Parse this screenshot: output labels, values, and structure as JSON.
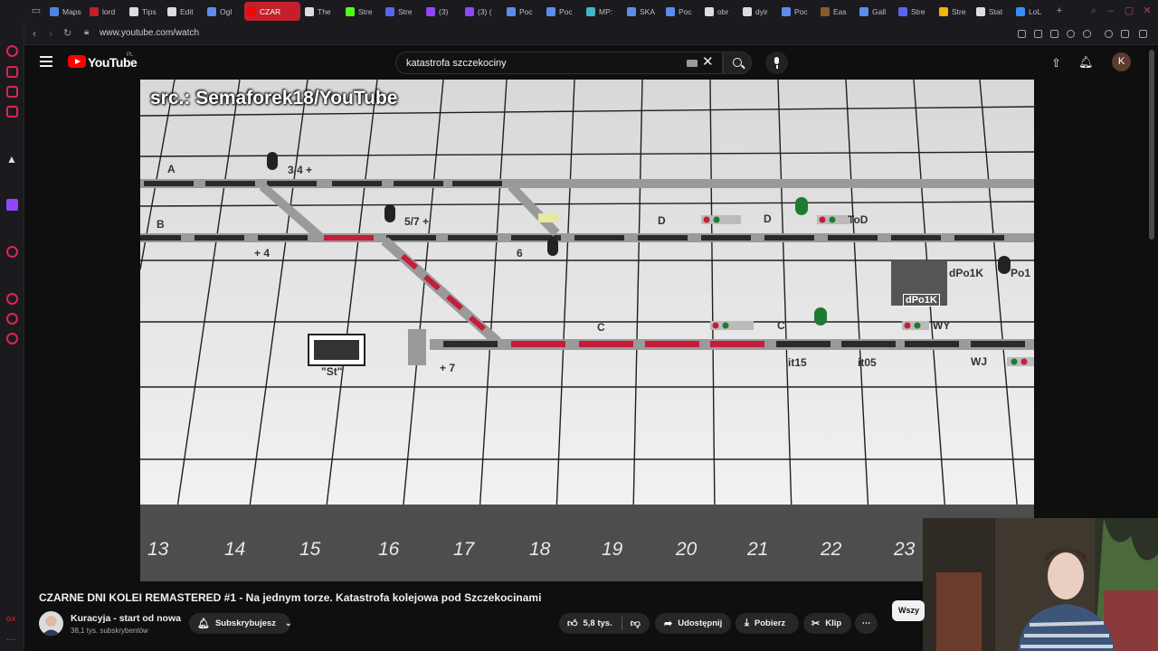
{
  "browser": {
    "tabs": [
      {
        "title": "Maps",
        "color": "#4a86e8"
      },
      {
        "title": "lord",
        "color": "#c0202c"
      },
      {
        "title": "Tips",
        "color": "#dddddd"
      },
      {
        "title": "Edit",
        "color": "#dddddd"
      },
      {
        "title": "Ogl",
        "color": "#5b8def"
      },
      {
        "title": "CZAR",
        "color": "#ff0000"
      },
      {
        "title": "The",
        "color": "#dddddd"
      },
      {
        "title": "Stre",
        "color": "#53fc18"
      },
      {
        "title": "Stre",
        "color": "#5865f2"
      },
      {
        "title": "(3)",
        "color": "#9146ff"
      },
      {
        "title": "(3) (",
        "color": "#9146ff"
      },
      {
        "title": "Poc",
        "color": "#5b8def"
      },
      {
        "title": "Poc",
        "color": "#5b8def"
      },
      {
        "title": "MP:",
        "color": "#3fb6c9"
      },
      {
        "title": "SKA",
        "color": "#5b8def"
      },
      {
        "title": "Poc",
        "color": "#5b8def"
      },
      {
        "title": "obr",
        "color": "#dddddd"
      },
      {
        "title": "dyir",
        "color": "#dddddd"
      },
      {
        "title": "Poc",
        "color": "#5b8def"
      },
      {
        "title": "Eas",
        "color": "#8b5a2b"
      },
      {
        "title": "Gall",
        "color": "#5b8def"
      },
      {
        "title": "Stre",
        "color": "#5865f2"
      },
      {
        "title": "Stre",
        "color": "#f4b400"
      },
      {
        "title": "Stat",
        "color": "#dddddd"
      },
      {
        "title": "LoL",
        "color": "#3b8cff"
      }
    ],
    "active_tab_index": 5,
    "url": "www.youtube.com/watch"
  },
  "youtube": {
    "logo_text": "YouTube",
    "country_code": "PL",
    "search_query": "katastrofa szczekociny",
    "avatar_letter": "K"
  },
  "video": {
    "credit": "src.: Semaforek18/YouTube",
    "ticks": [
      "13",
      "14",
      "15",
      "16",
      "17",
      "18",
      "19",
      "20",
      "21",
      "22",
      "23"
    ],
    "track_labels": [
      {
        "id": "A",
        "text": "A"
      },
      {
        "id": "B",
        "text": "B"
      },
      {
        "id": "s34",
        "text": "3/4 +"
      },
      {
        "id": "s57",
        "text": "5/7 +"
      },
      {
        "id": "p4",
        "text": "+ 4"
      },
      {
        "id": "p6",
        "text": "6"
      },
      {
        "id": "D1",
        "text": "D"
      },
      {
        "id": "D2",
        "text": "D"
      },
      {
        "id": "ToD",
        "text": "ToD"
      },
      {
        "id": "dPo1K",
        "text": "dPo1K"
      },
      {
        "id": "Po1",
        "text": "Po1"
      },
      {
        "id": "dPo1Kbox",
        "text": "dPo1K"
      },
      {
        "id": "C1",
        "text": "C"
      },
      {
        "id": "C2",
        "text": "C"
      },
      {
        "id": "WY",
        "text": "WY"
      },
      {
        "id": "it15",
        "text": "it15"
      },
      {
        "id": "it05",
        "text": "it05"
      },
      {
        "id": "WJ",
        "text": "WJ"
      },
      {
        "id": "St",
        "text": "\"St\""
      },
      {
        "id": "p7",
        "text": "+ 7"
      }
    ]
  },
  "details": {
    "title": "CZARNE DNI KOLEI REMASTERED #1 - Na jednym torze. Katastrofa kolejowa pod Szczekocinami",
    "channel_name": "Kuracyja - start od nowa",
    "subscribers": "38,1 tys. subskrybentów",
    "subscribe_label": "Subskrybujesz",
    "likes": "5,8 tys.",
    "share_label": "Udostępnij",
    "download_label": "Pobierz",
    "clip_label": "Klip",
    "next_chip_label": "Wszy"
  }
}
